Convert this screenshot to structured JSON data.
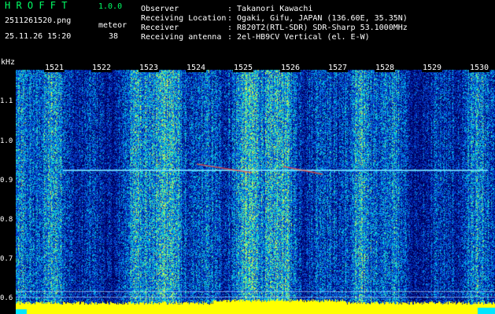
{
  "app": {
    "name": "H R O F F T",
    "version": "1.0.0"
  },
  "file": {
    "name": "2511261520.png",
    "timestamp": "25.11.26 15:20"
  },
  "detection": {
    "label": "meteor",
    "count": "38"
  },
  "station": [
    {
      "label": "Observer",
      "value": ": Takanori Kawachi"
    },
    {
      "label": "Receiving Location",
      "value": ": Ogaki, Gifu, JAPAN (136.60E, 35.35N)"
    },
    {
      "label": "Receiver",
      "value": ": R820T2(RTL-SDR) SDR-Sharp 53.1000MHz"
    },
    {
      "label": "Receiving antenna",
      "value": ": 2el-HB9CV Vertical (el. E-W)"
    }
  ],
  "axis": {
    "y_unit": "kHz",
    "y_ticks": [
      "1.1",
      "1.0",
      "0.9",
      "0.8",
      "0.7",
      "0.6"
    ],
    "x_ticks": [
      "1521",
      "1522",
      "1523",
      "1524",
      "1525",
      "1526",
      "1527",
      "1528",
      "1529",
      "1530"
    ]
  },
  "colors": {
    "background": "#000000",
    "accent": "#00ff66",
    "text": "#ffffff",
    "baseline": "#ffff00"
  }
}
